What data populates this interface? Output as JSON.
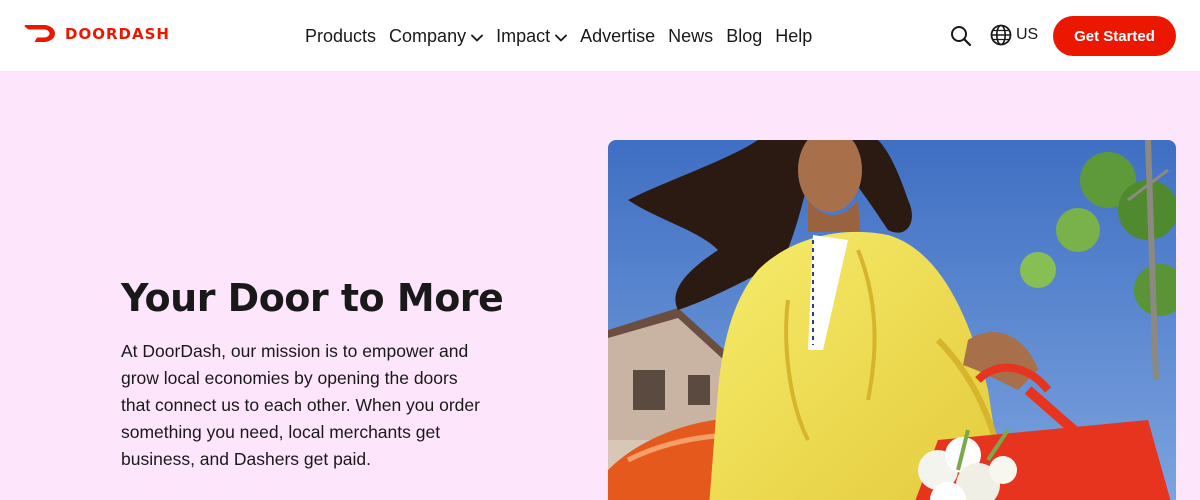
{
  "brand": {
    "name": "DOORDASH",
    "color": "#eb1700",
    "logo_icon": "doordash-dash-logo-icon"
  },
  "nav": {
    "items": [
      {
        "label": "Products",
        "has_dropdown": false
      },
      {
        "label": "Company",
        "has_dropdown": true
      },
      {
        "label": "Impact",
        "has_dropdown": true
      },
      {
        "label": "Advertise",
        "has_dropdown": false
      },
      {
        "label": "News",
        "has_dropdown": false
      },
      {
        "label": "Blog",
        "has_dropdown": false
      },
      {
        "label": "Help",
        "has_dropdown": false
      }
    ]
  },
  "header_actions": {
    "search_icon": "search-icon",
    "locale_icon": "globe-icon",
    "locale_label": "US",
    "cta_label": "Get Started"
  },
  "hero": {
    "title": "Your Door to More",
    "body": "At DoorDash, our mission is to empower and grow local economies by opening the doors that connect us to each other. When you order something you need, local merchants get business, and Dashers get paid.",
    "background_color": "#fde6fb",
    "image_description_icon": "hero-photo"
  }
}
